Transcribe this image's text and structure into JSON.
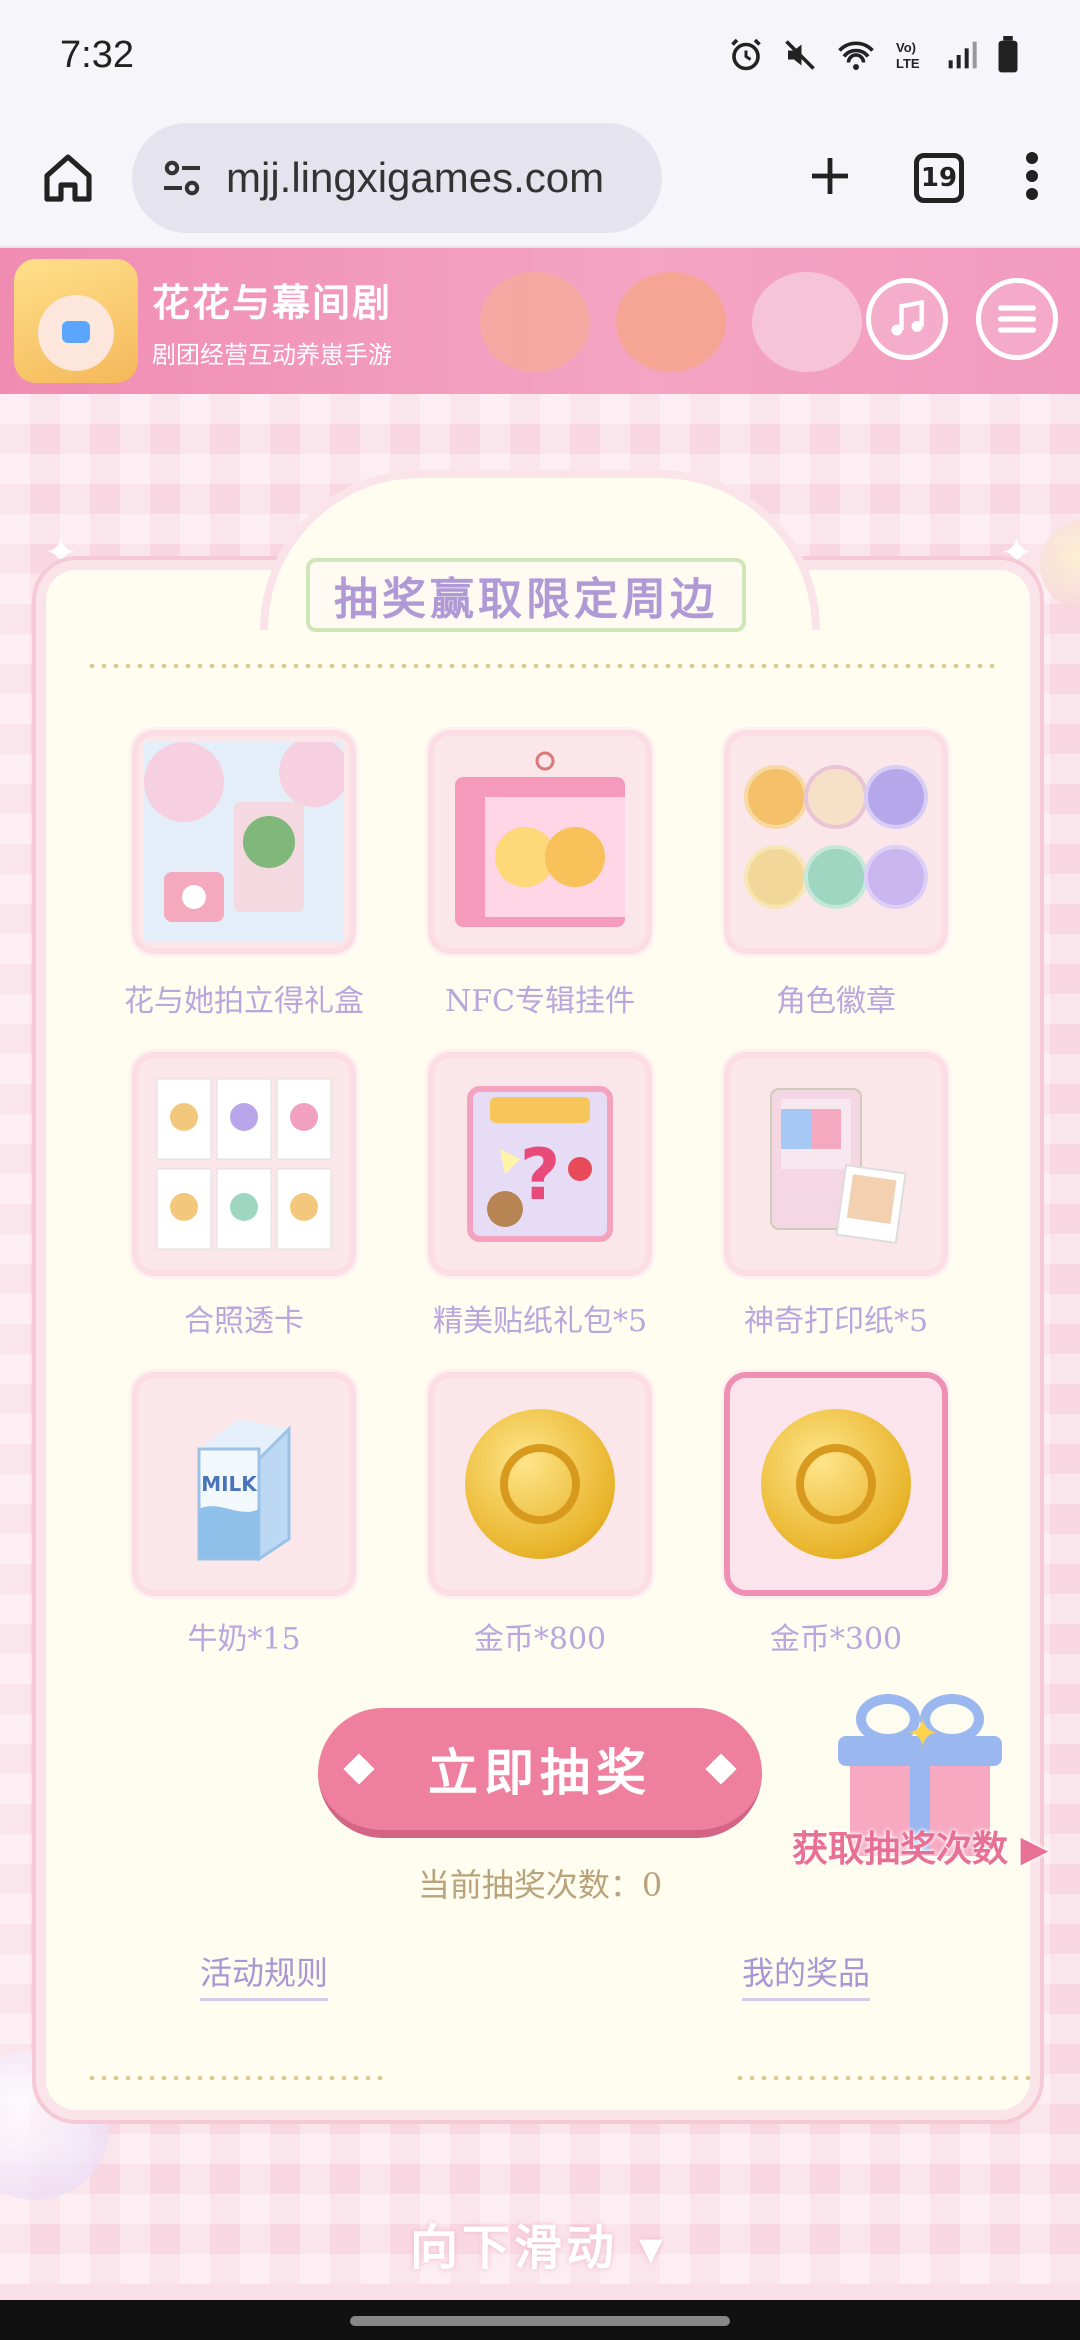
{
  "status_bar": {
    "time": "7:32",
    "icons": [
      "alarm-icon",
      "mute-icon",
      "wifi-icon",
      "volte-icon",
      "signal-icon",
      "battery-icon"
    ],
    "volte_label": "Vo)\nLTE"
  },
  "browser": {
    "url": "mjj.lingxigames.com",
    "tab_count": "19"
  },
  "site_header": {
    "title": "花花与幕间剧",
    "subtitle": "剧团经营互动养崽手游"
  },
  "panel": {
    "title": "抽奖赢取限定周边",
    "prizes": [
      {
        "label": "花与她拍立得礼盒"
      },
      {
        "label": "NFC专辑挂件"
      },
      {
        "label": "角色徽章"
      },
      {
        "label": "合照透卡"
      },
      {
        "label": "精美贴纸礼包*5"
      },
      {
        "label": "神奇打印纸*5"
      },
      {
        "label": "牛奶*15"
      },
      {
        "label": "金币*800"
      },
      {
        "label": "金币*300"
      }
    ],
    "draw_button": "立即抽奖",
    "draw_count": "当前抽奖次数：0",
    "rules_link": "活动规则",
    "my_prizes_link": "我的奖品",
    "get_chances": "获取抽奖次数 ▶"
  },
  "scroll_hint": "向下滑动 ▾",
  "colors": {
    "header_pink": "#f29bbf",
    "button_pink": "#ee7f9e",
    "label_lavender": "#b9a6dd",
    "panel_cream": "#fffcf0"
  }
}
